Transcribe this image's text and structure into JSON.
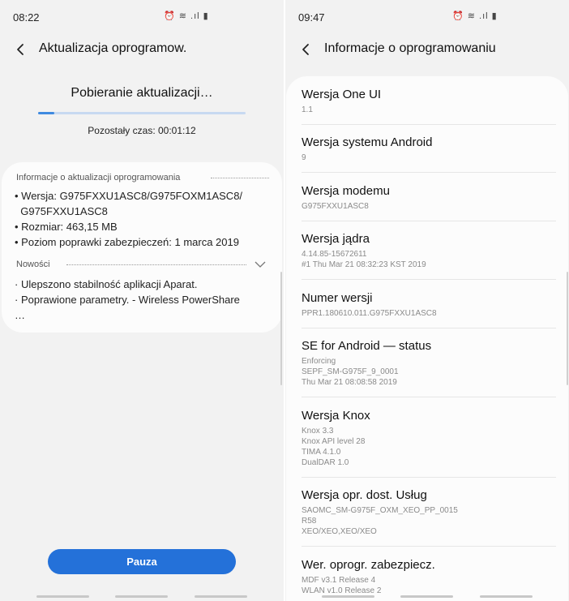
{
  "left": {
    "status_time": "08:22",
    "status_icons": "⏰ ≋ .ıl ▮",
    "title": "Aktualizacja oprogramow.",
    "download_title": "Pobieranie aktualizacji…",
    "progress": 0.08,
    "remaining": "Pozostały czas: 00:01:12",
    "info_header": "Informacje o aktualizacji oprogramowania",
    "info_lines": [
      "• Wersja: G975FXXU1ASC8/G975FOXM1ASC8/",
      "  G975FXXU1ASC8",
      "• Rozmiar: 463,15 MB",
      "• Poziom poprawki zabezpieczeń: 1 marca 2019"
    ],
    "news_header": "Nowości",
    "news_lines": [
      "· Ulepszono stabilność aplikacji Aparat.",
      "· Poprawione parametry. - Wireless PowerShare",
      "…"
    ],
    "pause_label": "Pauza"
  },
  "right": {
    "status_time": "09:47",
    "status_icons": "⏰ ≋ .ıl ▮",
    "title": "Informacje o oprogramowaniu",
    "items": [
      {
        "title": "Wersja One UI",
        "sub": [
          "1.1"
        ]
      },
      {
        "title": "Wersja systemu Android",
        "sub": [
          "9"
        ]
      },
      {
        "title": "Wersja modemu",
        "sub": [
          "G975FXXU1ASC8"
        ]
      },
      {
        "title": "Wersja jądra",
        "sub": [
          "4.14.85-15672611",
          "#1 Thu Mar 21 08:32:23 KST 2019"
        ]
      },
      {
        "title": "Numer wersji",
        "sub": [
          "PPR1.180610.011.G975FXXU1ASC8"
        ]
      },
      {
        "title": "SE for Android — status",
        "sub": [
          "Enforcing",
          "SEPF_SM-G975F_9_0001",
          "Thu Mar 21 08:08:58 2019"
        ]
      },
      {
        "title": "Wersja Knox",
        "sub": [
          "Knox 3.3",
          "Knox API level 28",
          "TIMA 4.1.0",
          "DualDAR 1.0"
        ]
      },
      {
        "title": "Wersja opr. dost. Usług",
        "sub": [
          "SAOMC_SM-G975F_OXM_XEO_PP_0015",
          "R58",
          "XEO/XEO,XEO/XEO"
        ]
      },
      {
        "title": "Wer. oprogr. zabezpiecz.",
        "sub": [
          "MDF v3.1 Release 4",
          "WLAN v1.0 Release 2"
        ]
      }
    ]
  }
}
